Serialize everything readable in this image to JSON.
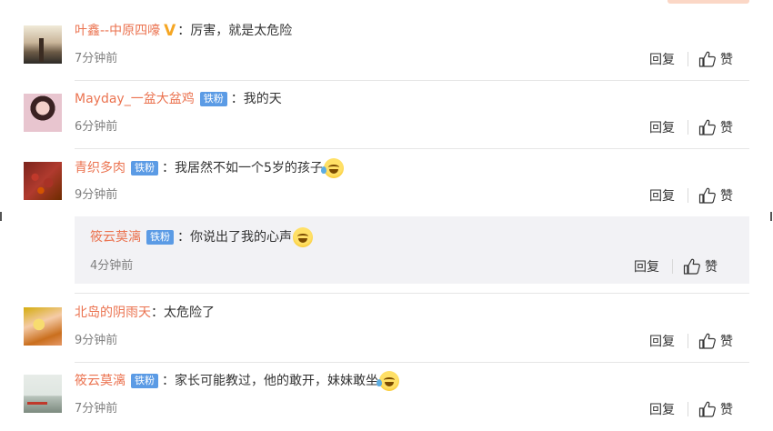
{
  "comments": [
    {
      "user": "叶鑫--中原四嚎",
      "vip_badge": "V",
      "colon": "：",
      "text": "厉害，就是太危险",
      "time": "7分钟前",
      "reply": "回复",
      "like": "赞"
    },
    {
      "user": "Mayday_一盆大盆鸡",
      "fan_badge": "铁粉",
      "colon": "：",
      "text": "我的天",
      "time": "6分钟前",
      "reply": "回复",
      "like": "赞"
    },
    {
      "user": "青织多肉",
      "fan_badge": "铁粉",
      "colon": "：",
      "text": "我居然不如一个5岁的孩子",
      "emoji": "crying-laughing-emoji",
      "time": "9分钟前",
      "reply": "回复",
      "like": "赞"
    },
    {
      "user": "北岛的阴雨天",
      "colon": "：",
      "text": "太危险了",
      "time": "9分钟前",
      "reply": "回复",
      "like": "赞"
    },
    {
      "user": "筱云莫漓",
      "fan_badge": "铁粉",
      "colon": "：",
      "text": "家长可能教过，他的敢开，妹妹敢坐",
      "emoji": "crying-laughing-emoji",
      "time": "7分钟前",
      "reply": "回复",
      "like": "赞"
    }
  ],
  "nested_reply": {
    "user": "筱云莫漓",
    "fan_badge": "铁粉",
    "colon": "：",
    "text": "你说出了我的心声",
    "emoji": "laughing-emoji",
    "time": "4分钟前",
    "reply": "回复",
    "like": "赞"
  },
  "colors": {
    "username": "#eb7350",
    "fan_badge_bg": "#5b9be5",
    "vip_badge": "#f5a623",
    "time": "#808080",
    "reply_bg": "#f2f2f5"
  }
}
